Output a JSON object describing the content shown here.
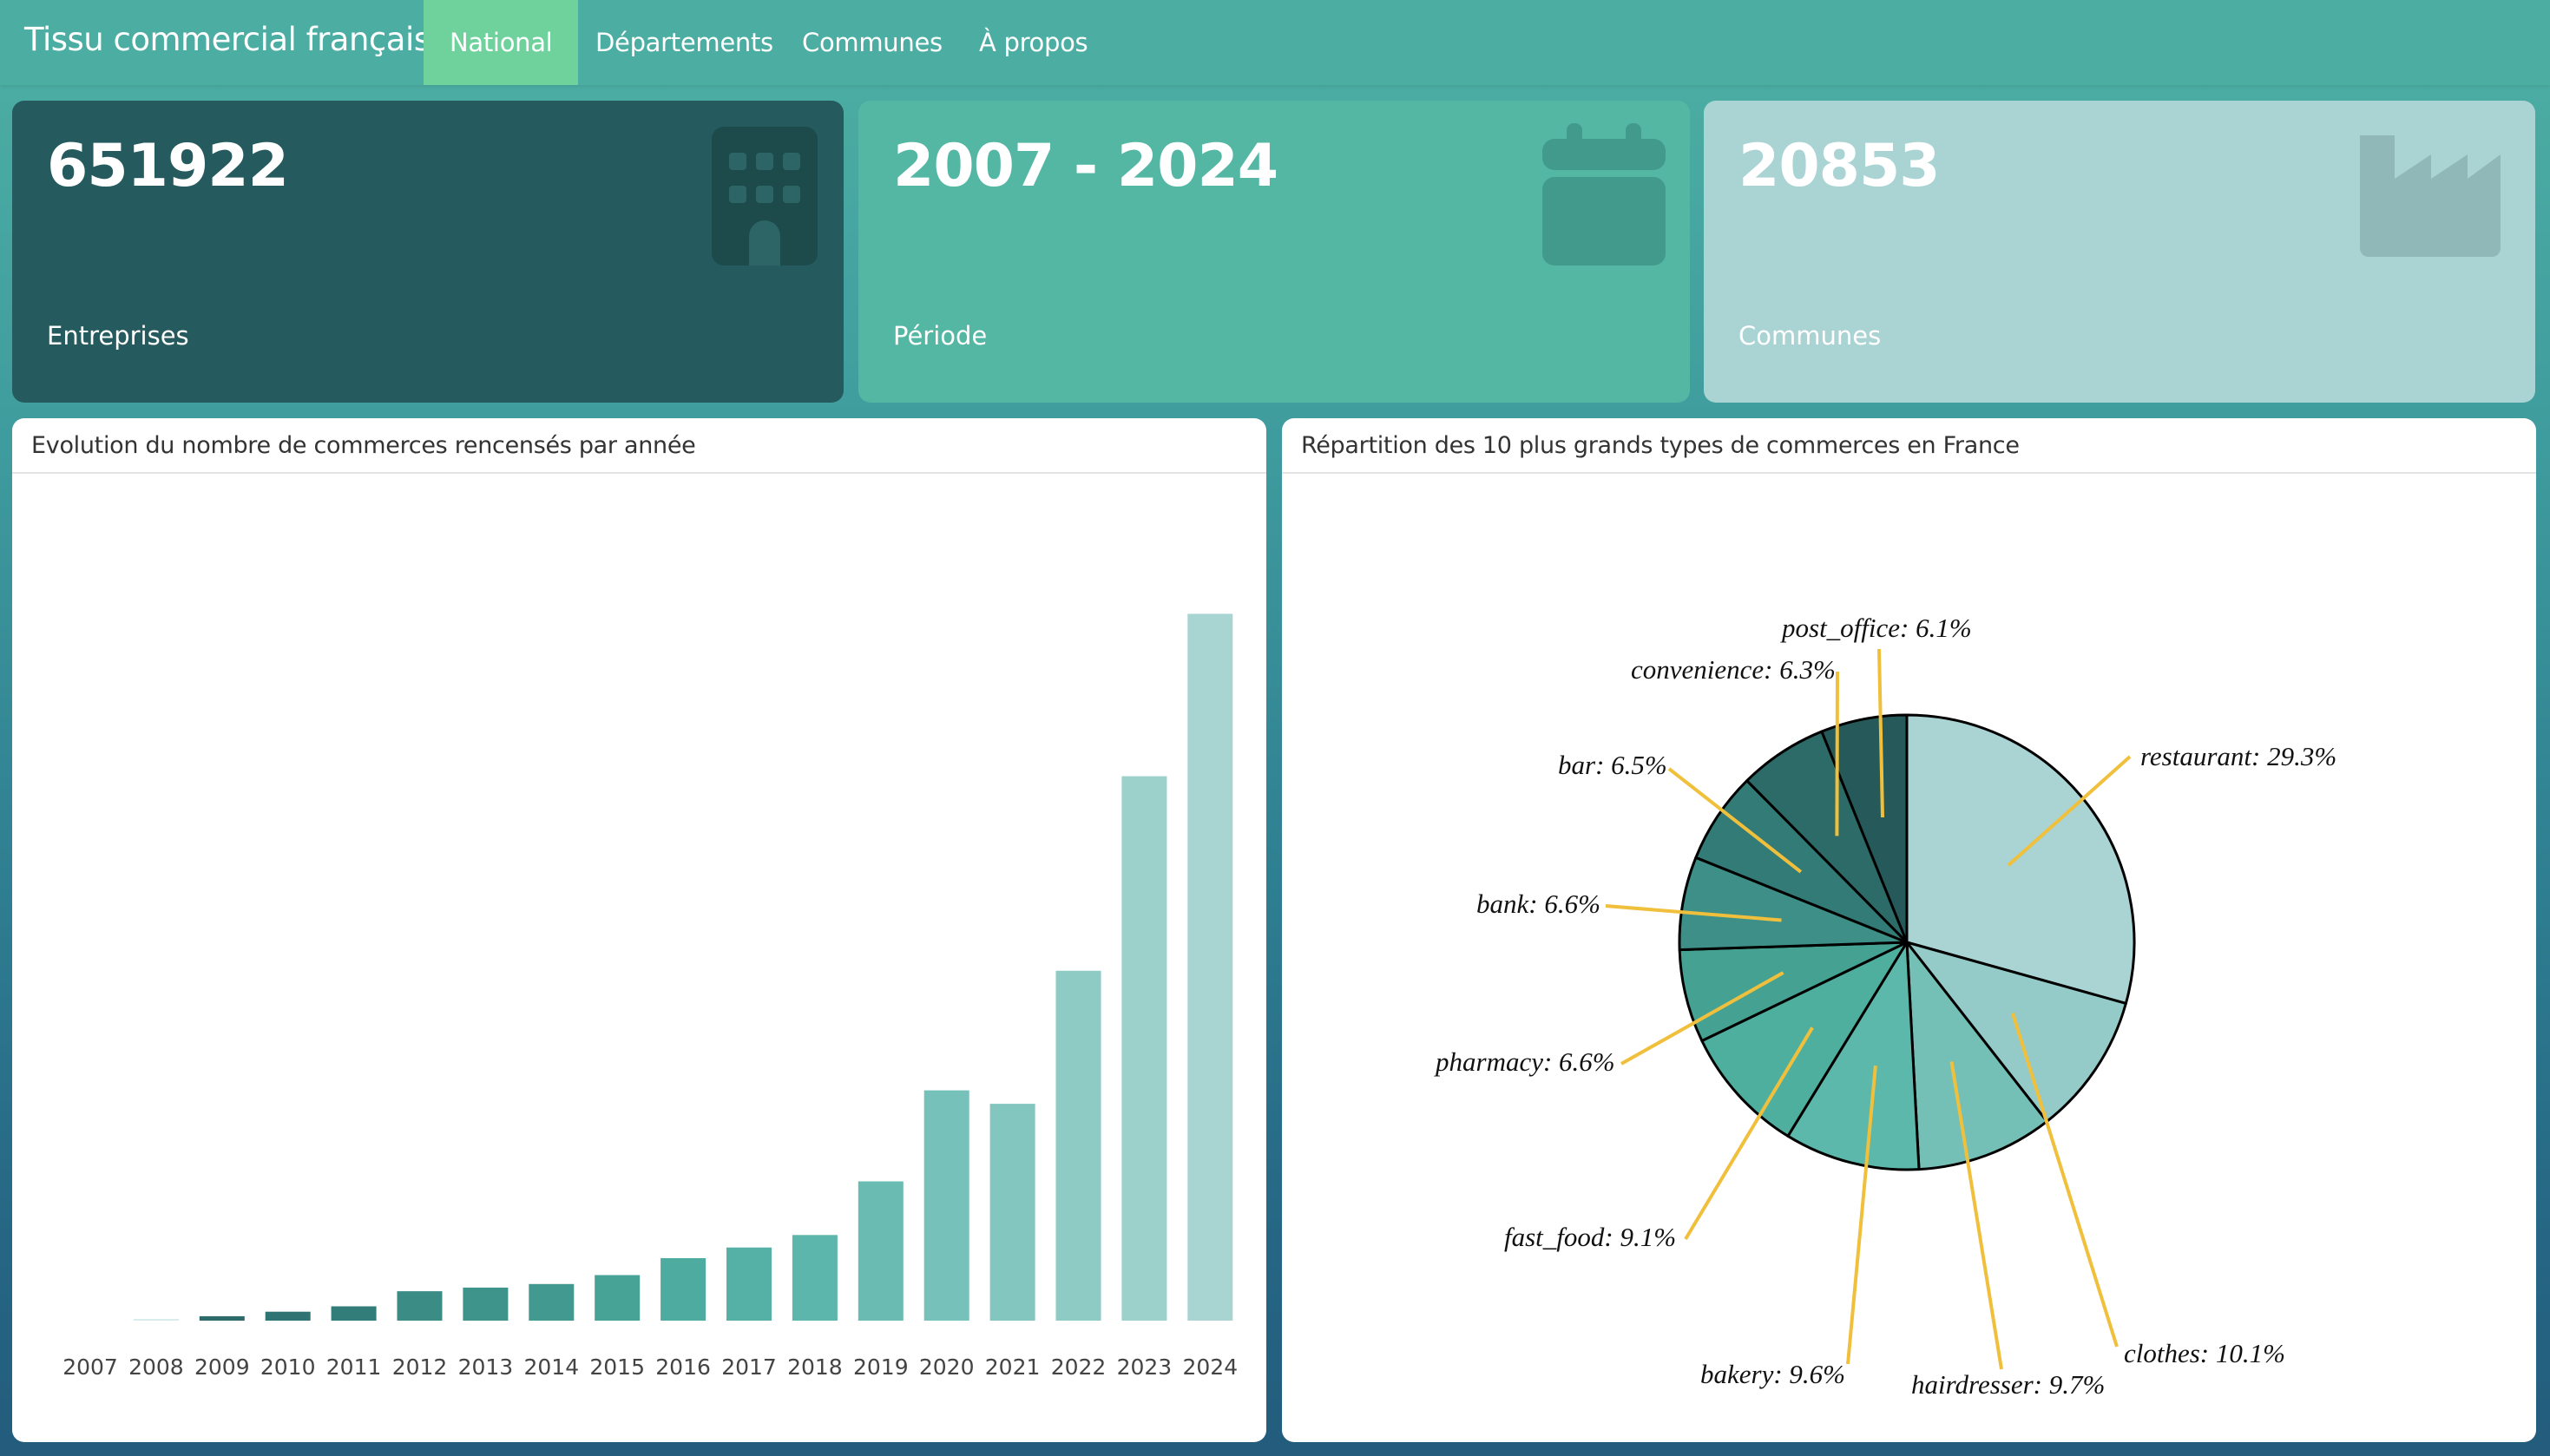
{
  "app": {
    "title": "Tissu commercial français",
    "tabs": [
      {
        "label": "National",
        "active": true
      },
      {
        "label": "Départements",
        "active": false
      },
      {
        "label": "Communes",
        "active": false
      },
      {
        "label": "À propos",
        "active": false
      }
    ]
  },
  "value_boxes": [
    {
      "value": "651922",
      "label": "Entreprises",
      "icon": "building-icon",
      "color": "#255b5e"
    },
    {
      "value": "2007 - 2024",
      "label": "Période",
      "icon": "calendar-icon",
      "color": "#53b7a4"
    },
    {
      "value": "20853",
      "label": "Communes",
      "icon": "industry-icon",
      "color": "#aad3d4"
    }
  ],
  "cards": {
    "bar_title": "Evolution du nombre de commerces rencensés par année",
    "pie_title": "Répartition des 10 plus grands types de commerces en France"
  },
  "chart_data": [
    {
      "type": "bar",
      "title": "Evolution du nombre de commerces rencensés par année",
      "categories": [
        "2007",
        "2008",
        "2009",
        "2010",
        "2011",
        "2012",
        "2013",
        "2014",
        "2015",
        "2016",
        "2017",
        "2018",
        "2019",
        "2020",
        "2021",
        "2022",
        "2023",
        "2024"
      ],
      "values": [
        0,
        900,
        2500,
        5000,
        8000,
        16500,
        18500,
        20500,
        25500,
        35000,
        41000,
        48000,
        78000,
        129000,
        121500,
        196000,
        305000,
        396000
      ],
      "ylim": [
        0,
        420000
      ],
      "grid": false,
      "colors": [
        "#e8f3f3",
        "#d6ecec",
        "#2d6b6b",
        "#2f7472",
        "#327d79",
        "#3a8c84",
        "#3e938a",
        "#42998f",
        "#48a397",
        "#4eaba0",
        "#55b1a6",
        "#5db6ab",
        "#6abcb2",
        "#76c1b9",
        "#83c6bf",
        "#8ecbc5",
        "#9bd0cb",
        "#a8d4d2"
      ]
    },
    {
      "type": "pie",
      "title": "Répartition des 10 plus grands types de commerces en France",
      "slices": [
        {
          "label": "restaurant",
          "value": 29.3,
          "color": "#aad3d4"
        },
        {
          "label": "clothes",
          "value": 10.1,
          "color": "#94cbc8"
        },
        {
          "label": "hairdresser",
          "value": 9.7,
          "color": "#74c0b7"
        },
        {
          "label": "bakery",
          "value": 9.6,
          "color": "#5cb8ab"
        },
        {
          "label": "fast_food",
          "value": 9.1,
          "color": "#4faf9f"
        },
        {
          "label": "pharmacy",
          "value": 6.6,
          "color": "#45a293"
        },
        {
          "label": "bank",
          "value": 6.6,
          "color": "#3d8f87"
        },
        {
          "label": "bar",
          "value": 6.5,
          "color": "#337b77"
        },
        {
          "label": "convenience",
          "value": 6.3,
          "color": "#2d6b69"
        },
        {
          "label": "post_office",
          "value": 6.1,
          "color": "#26595a"
        }
      ],
      "leader_color": "#f0c03c"
    }
  ]
}
